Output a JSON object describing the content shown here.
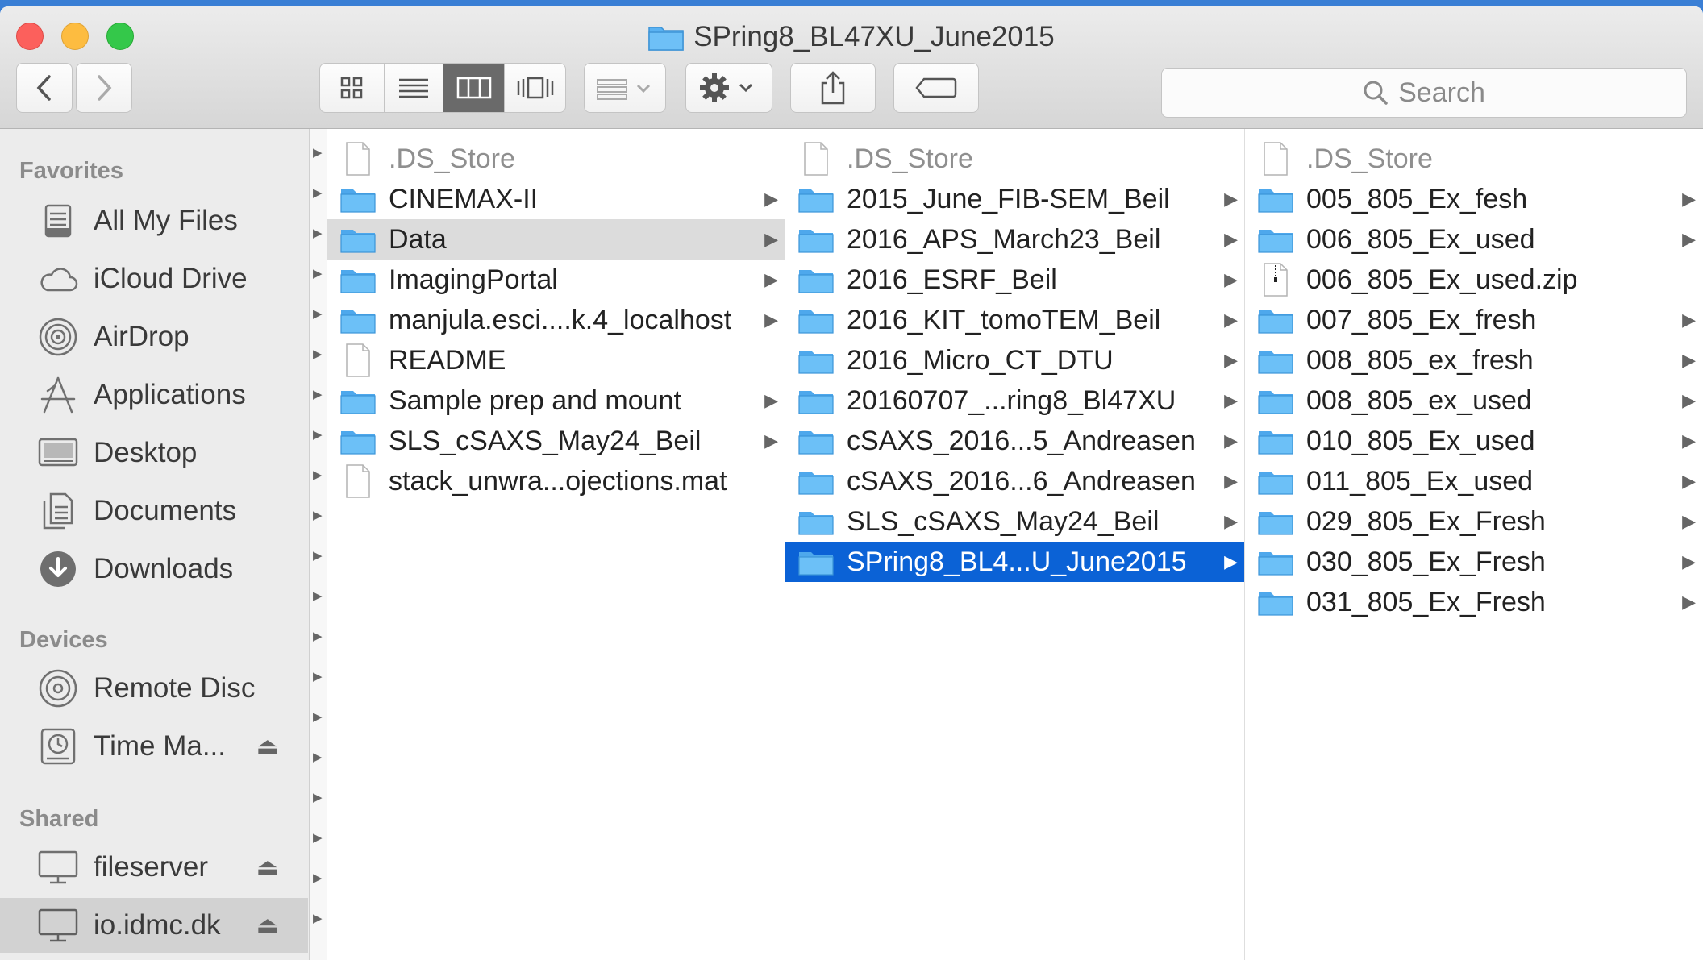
{
  "window": {
    "title": "SPring8_BL47XU_June2015"
  },
  "toolbar": {
    "back_icon": "chevron-left-icon",
    "forward_icon": "chevron-right-icon",
    "view_modes": [
      "icon-view",
      "list-view",
      "column-view",
      "cover-flow-view"
    ],
    "selected_view": "column-view",
    "search_placeholder": "Search"
  },
  "sidebar": {
    "favorites_header": "Favorites",
    "favorites": [
      {
        "label": "All My Files",
        "icon": "all-my-files-icon"
      },
      {
        "label": "iCloud Drive",
        "icon": "cloud-icon"
      },
      {
        "label": "AirDrop",
        "icon": "airdrop-icon"
      },
      {
        "label": "Applications",
        "icon": "applications-icon"
      },
      {
        "label": "Desktop",
        "icon": "desktop-icon"
      },
      {
        "label": "Documents",
        "icon": "documents-icon"
      },
      {
        "label": "Downloads",
        "icon": "downloads-icon"
      }
    ],
    "devices_header": "Devices",
    "devices": [
      {
        "label": "Remote Disc",
        "icon": "disc-icon"
      },
      {
        "label": "Time Ma...",
        "icon": "time-machine-icon",
        "eject": "⏏"
      }
    ],
    "shared_header": "Shared",
    "shared": [
      {
        "label": "fileserver",
        "icon": "display-icon",
        "eject": "⏏"
      },
      {
        "label": "io.idmc.dk",
        "icon": "display-icon",
        "eject": "⏏",
        "selected": true
      }
    ]
  },
  "columns": [
    {
      "items": [
        {
          "name": ".DS_Store",
          "kind": "file",
          "dim": true
        },
        {
          "name": "CINEMAX-II",
          "kind": "folder"
        },
        {
          "name": "Data",
          "kind": "folder",
          "highlight": true
        },
        {
          "name": "ImagingPortal",
          "kind": "folder"
        },
        {
          "name": "manjula.esci....k.4_localhost",
          "kind": "folder"
        },
        {
          "name": "README",
          "kind": "file"
        },
        {
          "name": "Sample prep and mount",
          "kind": "folder"
        },
        {
          "name": "SLS_cSAXS_May24_Beil",
          "kind": "folder"
        },
        {
          "name": "stack_unwra...ojections.mat",
          "kind": "file"
        }
      ]
    },
    {
      "items": [
        {
          "name": ".DS_Store",
          "kind": "file",
          "dim": true
        },
        {
          "name": "2015_June_FIB-SEM_Beil",
          "kind": "folder"
        },
        {
          "name": "2016_APS_March23_Beil",
          "kind": "folder"
        },
        {
          "name": "2016_ESRF_Beil",
          "kind": "folder"
        },
        {
          "name": "2016_KIT_tomoTEM_Beil",
          "kind": "folder"
        },
        {
          "name": "2016_Micro_CT_DTU",
          "kind": "folder"
        },
        {
          "name": "20160707_...ring8_Bl47XU",
          "kind": "folder"
        },
        {
          "name": "cSAXS_2016...5_Andreasen",
          "kind": "folder"
        },
        {
          "name": "cSAXS_2016...6_Andreasen",
          "kind": "folder"
        },
        {
          "name": "SLS_cSAXS_May24_Beil",
          "kind": "folder"
        },
        {
          "name": "SPring8_BL4...U_June2015",
          "kind": "folder",
          "selected": true
        }
      ]
    },
    {
      "items": [
        {
          "name": ".DS_Store",
          "kind": "file",
          "dim": true
        },
        {
          "name": "005_805_Ex_fesh",
          "kind": "folder"
        },
        {
          "name": "006_805_Ex_used",
          "kind": "folder"
        },
        {
          "name": "006_805_Ex_used.zip",
          "kind": "zip"
        },
        {
          "name": "007_805_Ex_fresh",
          "kind": "folder"
        },
        {
          "name": "008_805_ex_fresh",
          "kind": "folder"
        },
        {
          "name": "008_805_ex_used",
          "kind": "folder"
        },
        {
          "name": "010_805_Ex_used",
          "kind": "folder"
        },
        {
          "name": "011_805_Ex_used",
          "kind": "folder"
        },
        {
          "name": "029_805_Ex_Fresh",
          "kind": "folder"
        },
        {
          "name": "030_805_Ex_Fresh",
          "kind": "folder"
        },
        {
          "name": "031_805_Ex_Fresh",
          "kind": "folder"
        }
      ]
    }
  ],
  "colors": {
    "selection": "#0b62d6",
    "folder_fill": "#5ab2f2",
    "sidebar_bg": "#ececec"
  }
}
